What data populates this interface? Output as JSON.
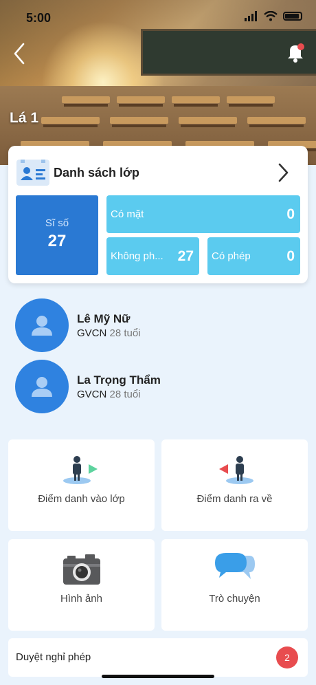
{
  "status_bar": {
    "time": "5:00"
  },
  "header": {
    "class_name": "Lá 1"
  },
  "class_card": {
    "title": "Danh sách lớp",
    "total_label": "Sĩ số",
    "total_value": "27",
    "present_label": "Có mặt",
    "present_value": "0",
    "absent_label": "Không ph...",
    "absent_value": "27",
    "excused_label": "Có phép",
    "excused_value": "0"
  },
  "teachers": [
    {
      "name": "Lê Mỹ Nữ",
      "role": "GVCN",
      "age": "28 tuổi"
    },
    {
      "name": "La Trọng Thẩm",
      "role": "GVCN",
      "age": "28 tuổi"
    }
  ],
  "actions": {
    "checkin_label": "Điểm danh vào lớp",
    "checkout_label": "Điểm danh ra về",
    "photos_label": "Hình ảnh",
    "chat_label": "Trò chuyện"
  },
  "leave": {
    "label": "Duyệt nghỉ phép",
    "badge": "2"
  },
  "colors": {
    "primary_blue": "#2a79d3",
    "light_blue": "#5bcbef",
    "badge_red": "#e84c4f",
    "background": "#eaf3fc"
  }
}
